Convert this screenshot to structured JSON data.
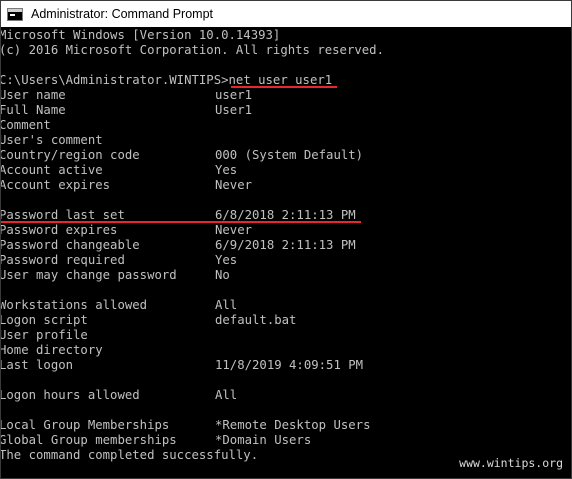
{
  "window": {
    "title": "Administrator: Command Prompt",
    "icon": "cmd-console-icon"
  },
  "console": {
    "header_line1": "Microsoft Windows [Version 10.0.14393]",
    "header_line2": "(c) 2016 Microsoft Corporation. All rights reserved.",
    "prompt": "C:\\Users\\Administrator.WINTIPS>",
    "command": "net user user1",
    "fields": [
      {
        "label": "User name",
        "value": "user1"
      },
      {
        "label": "Full Name",
        "value": "User1"
      },
      {
        "label": "Comment",
        "value": ""
      },
      {
        "label": "User's comment",
        "value": ""
      },
      {
        "label": "Country/region code",
        "value": "000 (System Default)"
      },
      {
        "label": "Account active",
        "value": "Yes"
      },
      {
        "label": "Account expires",
        "value": "Never"
      },
      {
        "label": "Password last set",
        "value": "6/8/2018 2:11:13 PM"
      },
      {
        "label": "Password expires",
        "value": "Never"
      },
      {
        "label": "Password changeable",
        "value": "6/9/2018 2:11:13 PM"
      },
      {
        "label": "Password required",
        "value": "Yes"
      },
      {
        "label": "User may change password",
        "value": "No"
      },
      {
        "label": "Workstations allowed",
        "value": "All"
      },
      {
        "label": "Logon script",
        "value": "default.bat"
      },
      {
        "label": "User profile",
        "value": ""
      },
      {
        "label": "Home directory",
        "value": ""
      },
      {
        "label": "Last logon",
        "value": "11/8/2019 4:09:51 PM"
      },
      {
        "label": "Logon hours allowed",
        "value": "All"
      },
      {
        "label": "Local Group Memberships",
        "value": "*Remote Desktop Users"
      },
      {
        "label": "Global Group memberships",
        "value": "*Domain Users"
      }
    ],
    "footer": "The command completed successfully."
  },
  "watermark": "www.wintips.org",
  "colors": {
    "console_bg": "#000000",
    "console_text": "#c0c0c0",
    "highlight_underline": "#e8262d",
    "titlebar_bg": "#ffffff"
  }
}
